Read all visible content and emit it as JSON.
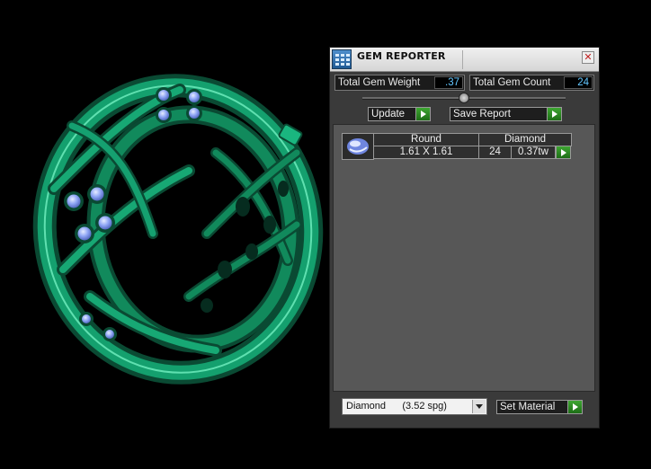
{
  "window": {
    "title": "GEM REPORTER",
    "close_symbol": "✕"
  },
  "stats": {
    "total_weight_label": "Total Gem Weight",
    "total_weight_value": ".37",
    "total_count_label": "Total Gem Count",
    "total_count_value": "24"
  },
  "buttons": {
    "update_label": "Update",
    "save_report_label": "Save Report",
    "set_material_label": "Set Material"
  },
  "report": {
    "rows": [
      {
        "shape": "Round",
        "material": "Diamond",
        "size": "1.61 X 1.61",
        "count": "24",
        "weight": "0.37tw"
      }
    ]
  },
  "material_select": {
    "value": "Diamond      (3.52 spg)"
  },
  "icons": {
    "app": "gem-report-icon",
    "close": "close-icon",
    "arrow": "play-arrow-icon",
    "dropdown": "chevron-down-icon",
    "gem": "round-gem-icon"
  },
  "colors": {
    "ring_green": "#139a6a",
    "gem_blue": "#8fa6f5",
    "value_text": "#62c6ff",
    "arrow_green": "#3ea632"
  }
}
